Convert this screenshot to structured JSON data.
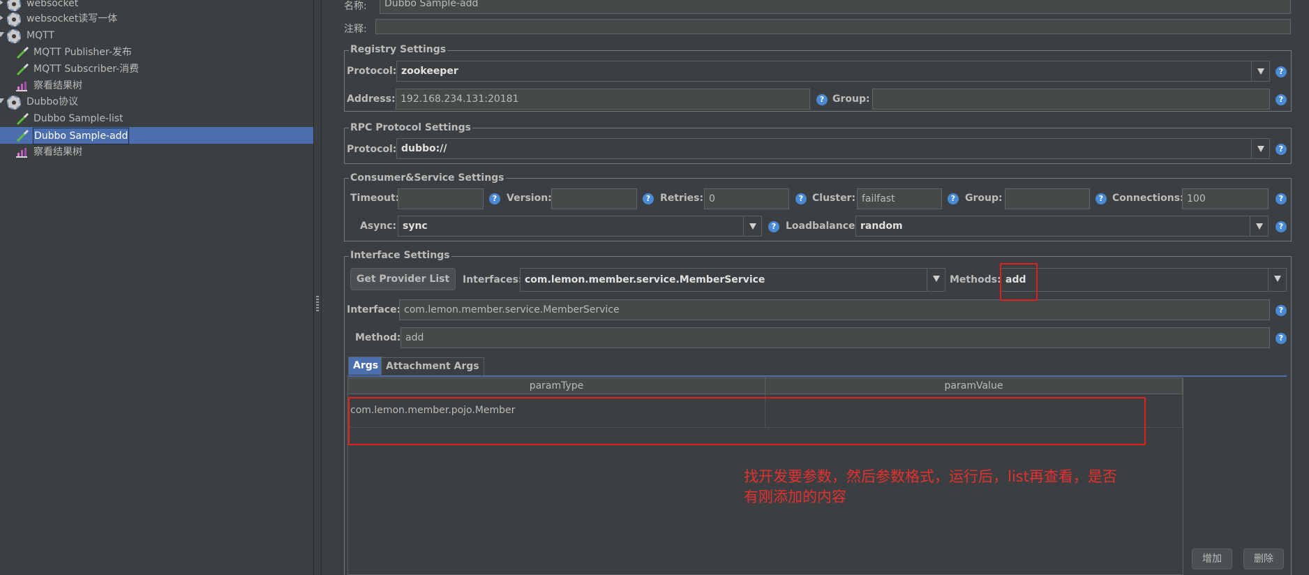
{
  "tree": {
    "items": [
      {
        "label": "websocket"
      },
      {
        "label": "websocket读写一体"
      },
      {
        "label": "MQTT"
      },
      {
        "label": "MQTT Publisher-发布"
      },
      {
        "label": "MQTT Subscriber-消费"
      },
      {
        "label": "察看结果树"
      },
      {
        "label": "Dubbo协议"
      },
      {
        "label": "Dubbo Sample-list"
      },
      {
        "label": "Dubbo Sample-add"
      },
      {
        "label": "察看结果树"
      }
    ],
    "selected_index": 8
  },
  "form": {
    "name_label": "名称:",
    "name_value": "Dubbo Sample-add",
    "comment_label": "注释:",
    "comment_value": ""
  },
  "registry": {
    "title": "Registry Settings",
    "protocol_label": "Protocol:",
    "protocol_value": "zookeeper",
    "address_label": "Address:",
    "address_value": "192.168.234.131:20181",
    "group_label": "Group:",
    "group_value": ""
  },
  "rpc": {
    "title": "RPC Protocol Settings",
    "protocol_label": "Protocol:",
    "protocol_value": "dubbo://"
  },
  "consumer": {
    "title": "Consumer&Service Settings",
    "timeout_label": "Timeout:",
    "timeout_value": "",
    "version_label": "Version:",
    "version_value": "",
    "retries_label": "Retries:",
    "retries_value": "0",
    "cluster_label": "Cluster:",
    "cluster_value": "failfast",
    "group_label": "Group:",
    "group_value": "",
    "connections_label": "Connections:",
    "connections_value": "100",
    "async_label": "Async:",
    "async_value": "sync",
    "loadbalance_label": "Loadbalance:",
    "loadbalance_value": "random"
  },
  "interface": {
    "title": "Interface Settings",
    "get_provider_button": "Get Provider List",
    "interfaces_label": "Interfaces:",
    "interfaces_value": "com.lemon.member.service.MemberService",
    "methods_label": "Methods:",
    "methods_value": "add",
    "interface_label": "Interface:",
    "interface_value": "com.lemon.member.service.MemberService",
    "method_label": "Method:",
    "method_value": "add"
  },
  "args": {
    "tabs": [
      {
        "label": "Args",
        "active": true
      },
      {
        "label": "Attachment Args",
        "active": false
      }
    ],
    "columns": [
      "paramType",
      "paramValue"
    ],
    "rows": [
      [
        "com.lemon.member.pojo.Member",
        ""
      ]
    ],
    "add_button": "增加",
    "delete_button": "删除"
  },
  "annotation": {
    "line1": "找开发要参数，然后参数格式，运行后，list再查看，是否",
    "line2": "有刚添加的内容"
  },
  "colors": {
    "background": "#3c3f41",
    "selection": "#4b6eaf",
    "annotation": "#e02020",
    "help": "#4a8ad4"
  }
}
